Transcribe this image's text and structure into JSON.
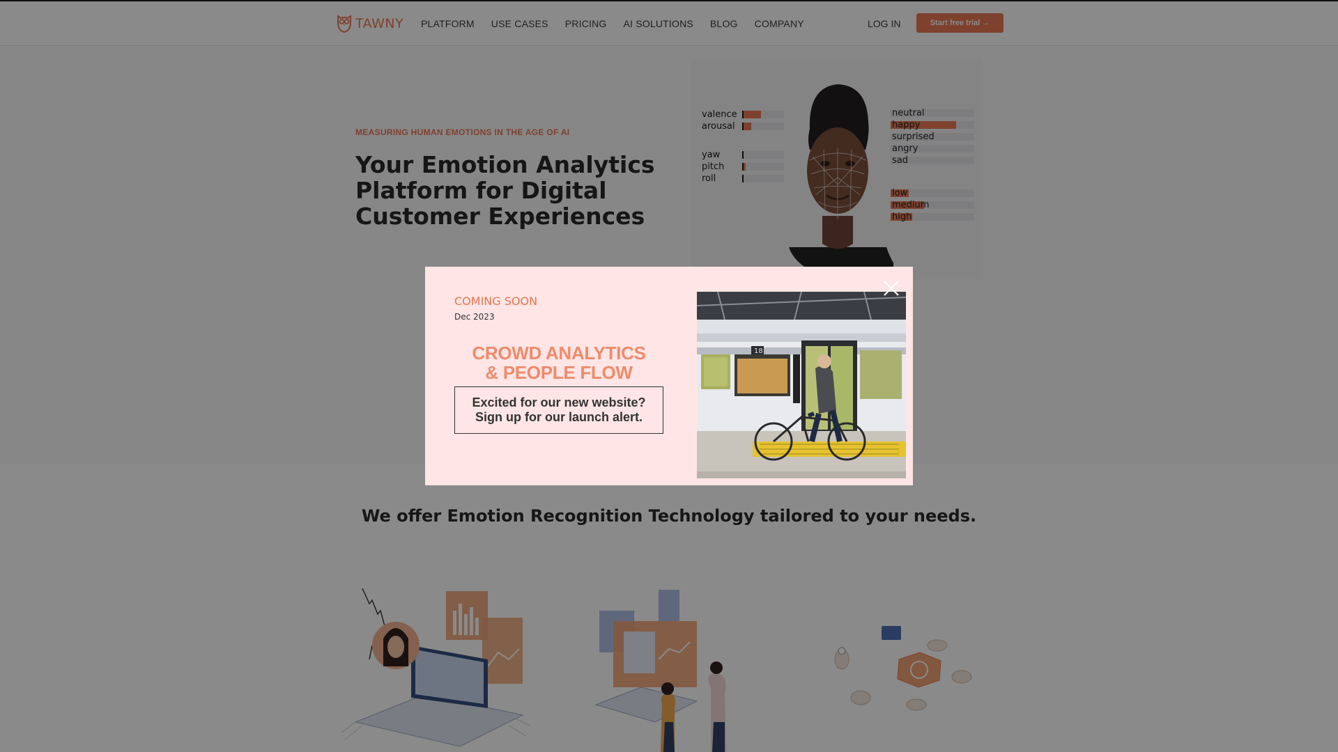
{
  "header": {
    "logo_text": "TAWNY",
    "nav": [
      "PLATFORM",
      "USE CASES",
      "PRICING",
      "AI SOLUTIONS",
      "BLOG",
      "COMPANY"
    ],
    "login": "LOG IN",
    "cta": "Start free trial →"
  },
  "hero": {
    "eyebrow": "MEASURING HUMAN EMOTIONS IN THE AGE OF AI",
    "title": "Your Emotion Analytics Platform for Digital Customer Experiences"
  },
  "metrics_left": [
    {
      "label": "valence",
      "value": 0.45
    },
    {
      "label": "arousal",
      "value": 0.22
    },
    {
      "label": "yaw",
      "value": 0.03
    },
    {
      "label": "pitch",
      "value": 0.08
    },
    {
      "label": "roll",
      "value": 0.03
    }
  ],
  "metrics_right": [
    {
      "label": "neutral",
      "value": 0.0
    },
    {
      "label": "happy",
      "value": 0.78
    },
    {
      "label": "surprised",
      "value": 0.0
    },
    {
      "label": "angry",
      "value": 0.0
    },
    {
      "label": "sad",
      "value": 0.0
    },
    {
      "label": "low",
      "value": 0.22
    },
    {
      "label": "medium",
      "value": 0.4
    },
    {
      "label": "high",
      "value": 0.26
    }
  ],
  "section2": {
    "title": "We offer Emotion Recognition Technology tailored to your needs."
  },
  "modal": {
    "eyebrow": "COMING SOON",
    "date": "Dec 2023",
    "title_line1": "CROWD ANALYTICS",
    "title_line2": "& PEOPLE FLOW",
    "signup_line1": "Excited for our new website?",
    "signup_line2": "Sign up for our launch alert.",
    "photo_sign_number": "18"
  },
  "colors": {
    "accent": "#e8744e",
    "modal_bg": "#ffe5e5",
    "overlay": "rgba(10,10,10,0.48)"
  },
  "icons": {
    "logo": "owl-icon",
    "close": "close-icon"
  }
}
